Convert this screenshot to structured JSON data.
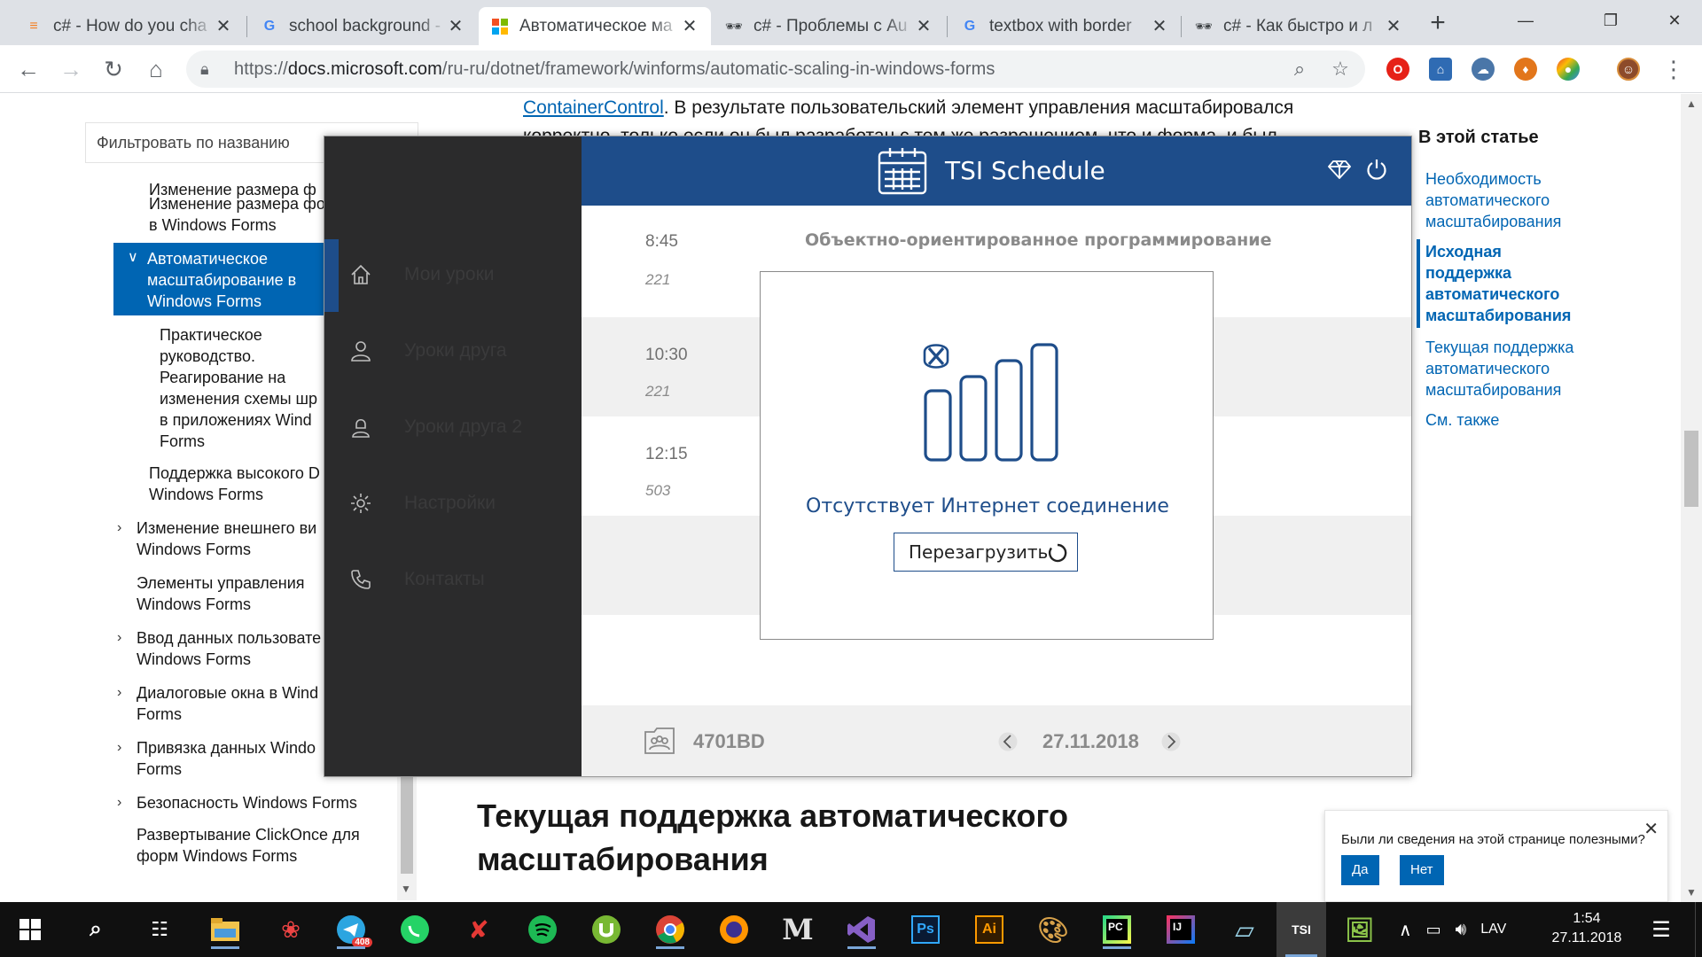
{
  "browser": {
    "tabs": [
      {
        "title": "c# - How do you cha",
        "favicon": "stackoverflow-icon"
      },
      {
        "title": "school background -",
        "favicon": "google-icon"
      },
      {
        "title": "Автоматическое ма",
        "favicon": "microsoft-icon",
        "active": true
      },
      {
        "title": "c# - Проблемы с Au",
        "favicon": "glasses-icon"
      },
      {
        "title": "textbox with border",
        "favicon": "google-icon"
      },
      {
        "title": "c# - Как быстро и л",
        "favicon": "glasses-icon"
      }
    ],
    "url_prefix": "https://",
    "url_host": "docs.microsoft.com",
    "url_path": "/ru-ru/dotnet/framework/winforms/automatic-scaling-in-windows-forms"
  },
  "docs": {
    "filter_placeholder": "Фильтровать по названию",
    "nav": {
      "cut_top": "Изменение размера ф",
      "item_resize": "Изменение размера фо",
      "item_resize_2": "в Windows Forms",
      "active_1": "Автоматическое",
      "active_2": "масштабирование в",
      "active_3": "Windows Forms",
      "sub_1": "Практическое",
      "sub_2": "руководство.",
      "sub_3": "Реагирование на",
      "sub_4": "изменения схемы шр",
      "sub_5": "в приложениях Wind",
      "sub_6": "Forms",
      "dpi_1": "Поддержка высокого D",
      "dpi_2": "Windows Forms",
      "look_1": "Изменение внешнего ви",
      "look_2": "Windows Forms",
      "ctl_1": "Элементы управления",
      "ctl_2": "Windows Forms",
      "input_1": "Ввод данных пользовате",
      "input_2": "Windows Forms",
      "dlg_1": "Диалоговые окна в Wind",
      "dlg_2": "Forms",
      "bind_1": "Привязка данных Windo",
      "bind_2": "Forms",
      "sec": "Безопасность Windows Forms",
      "click_1": "Развертывание ClickOnce для",
      "click_2": "форм Windows Forms"
    },
    "body_link": "ContainerControl",
    "body_line1": ". В результате пользовательский элемент управления масштабировался",
    "body_line2": "корректно, только если он был разработан с тем же разрешением, что и форма, и был",
    "heading_1": "Текущая поддержка автоматического",
    "heading_2": "масштабирования",
    "toc_title": "В этой статье",
    "toc": [
      {
        "l1": "Необходимость",
        "l2": "автоматического",
        "l3": "масштабирования"
      },
      {
        "l1": "Исходная",
        "l2": "поддержка",
        "l3": "автоматического",
        "l4": "масштабирования",
        "active": true
      },
      {
        "l1": "Текущая поддержка",
        "l2": "автоматического",
        "l3": "масштабирования"
      },
      {
        "l1": "См. также"
      }
    ],
    "feedback": {
      "question": "Были ли сведения на этой странице полезными?",
      "yes": "Да",
      "no": "Нет"
    }
  },
  "app": {
    "title": "TSI Schedule",
    "menu": [
      {
        "label": "Мои  уроки",
        "icon": "home-icon"
      },
      {
        "label": "Уроки друга",
        "icon": "person-icon"
      },
      {
        "label": "Уроки друга 2",
        "icon": "person-alt-icon"
      },
      {
        "label": "Настройки",
        "icon": "gear-icon"
      },
      {
        "label": "Контакты",
        "icon": "phone-icon"
      }
    ],
    "lessons": [
      {
        "time": "8:45",
        "room": "221",
        "subject": "Объектно-ориентированное программирование"
      },
      {
        "time": "10:30",
        "room": "221"
      },
      {
        "time": "12:15",
        "room": "503"
      }
    ],
    "dialog": {
      "message": "Отсутствует Интернет соединение",
      "button": "Перезагрузить"
    },
    "footer": {
      "group": "4701BD",
      "date": "27.11.2018"
    },
    "colors": {
      "accent": "#1e4d8a",
      "sidebar": "#2b2b2c"
    }
  },
  "taskbar": {
    "telegram_badge": "408",
    "app_tsi": "TSI",
    "lang": "LAV",
    "time": "1:54",
    "date": "27.11.2018"
  }
}
